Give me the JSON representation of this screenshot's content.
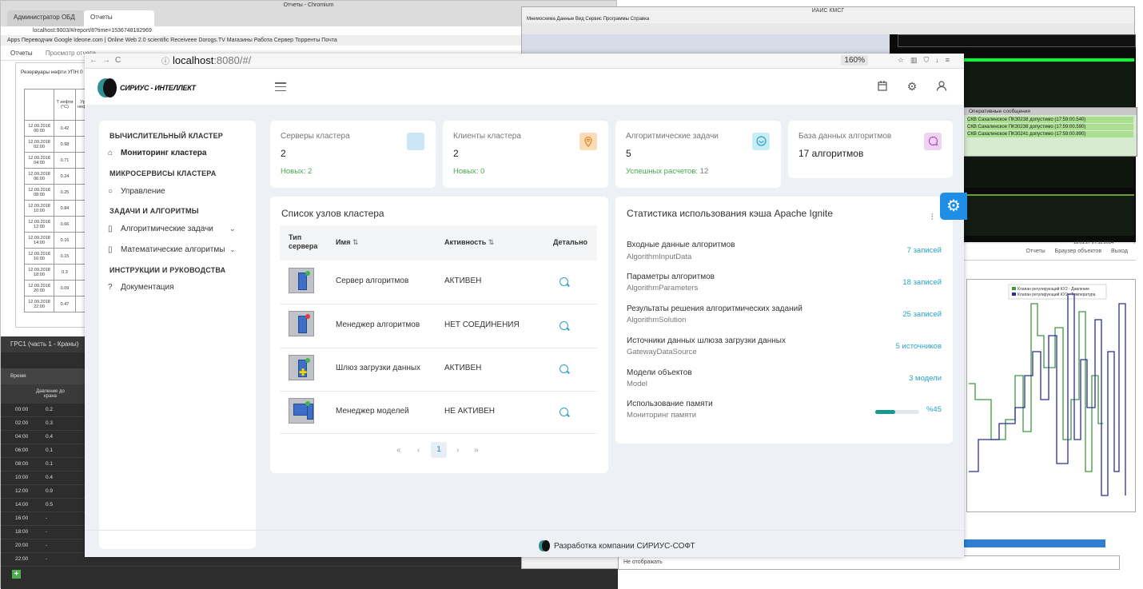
{
  "bg_left": {
    "tab1": "Администратор ОБД",
    "tab2": "Отчеты",
    "window_title": "Отчеты - Chromium",
    "url": "localhost:9003/#/report/8?time=1536748182969",
    "bookmarks": "Apps   Переводчик Google   Ideone.com | Online   Web 2.0 scientific   Receiveee   Dorogs.TV   Магазины   Работа   Сервер   Торренты   Почта",
    "nav_reports": "Отчеты",
    "nav_view": "Просмотр отчета",
    "report_title": "Резервуары нефти УПН 0",
    "table_header": [
      "Т нефти (°C)",
      "Ур нефт"
    ],
    "table_rows": [
      [
        "12.09.2018 00:00",
        "0.42"
      ],
      [
        "12.09.2018 02:00",
        "0.98"
      ],
      [
        "12.09.2018 04:00",
        "0.71"
      ],
      [
        "12.09.2018 06:00",
        "0.24"
      ],
      [
        "12.09.2018 08:00",
        "0.25"
      ],
      [
        "12.09.2018 10:00",
        "0.84"
      ],
      [
        "12.09.2018 12:00",
        "0.66"
      ],
      [
        "12.09.2018 14:00",
        "0.16"
      ],
      [
        "12.09.2018 16:00",
        "0.15"
      ],
      [
        "12.09.2018 18:00",
        "0.3"
      ],
      [
        "12.09.2018 20:00",
        "0.09"
      ],
      [
        "12.09.2018 22:00",
        "0.47"
      ]
    ],
    "dark_title": "ГРС1 (часть 1 - Краны)",
    "dark_col_time": "Время",
    "dark_col_pressure": "Давление до крана",
    "dark_rows": [
      [
        "00:00",
        "0.2"
      ],
      [
        "02:00",
        "0.3"
      ],
      [
        "04:00",
        "0.4"
      ],
      [
        "06:00",
        "0.1"
      ],
      [
        "08:00",
        "0.1"
      ],
      [
        "10:00",
        "0.4"
      ],
      [
        "12:00",
        "0.9"
      ],
      [
        "14:00",
        "0.5"
      ],
      [
        "16:00",
        "-"
      ],
      [
        "18:00",
        "-"
      ],
      [
        "20:00",
        "-"
      ],
      [
        "22:00",
        "-"
      ]
    ]
  },
  "bg_right": {
    "window_title": "ИАИС КМСГ",
    "menu": "Мнемосхема   Данные   Вид   Сервис   Программы   Справка",
    "ops_title": "Оперативные сообщения",
    "ops_lines": [
      "СКВ Сахалинское ПКЗ0238 допустимо (17:59:00.540)",
      "СКВ Сахалинское ПКЗ0238 допустимо (17:59:00.590)",
      "СКВ Сахалинское ПКЗ0241 допустимо (17:59:00.890)"
    ],
    "lower_nav": [
      "Отчеты",
      "Браузер объектов",
      "Выход"
    ],
    "legend1": "Клапан регулирующий КУ2 - Давление",
    "legend2": "Клапан регулирующий КУ2 - Температура",
    "select_value": "Не отображать",
    "clock": "18:01:27  27.11.2014"
  },
  "browser": {
    "url_host": "localhost",
    "url_rest": ":8080/#/",
    "zoom": "160%"
  },
  "app": {
    "logo_text": "СИРИУС - ИНТЕЛЛЕКТ",
    "sidebar": {
      "section1": "ВЫЧИСЛИТЕЛЬНЫЙ КЛАСТЕР",
      "item_monitoring": "Мониторинг кластера",
      "section2": "МИКРОСЕРВИСЫ КЛАСТЕРА",
      "item_management": "Управление",
      "section3": "ЗАДАЧИ И АЛГОРИТМЫ",
      "item_algo_tasks": "Алгоритмические задачи",
      "item_math_algos": "Математические алгоритмы",
      "section4": "ИНСТРУКЦИИ И РУКОВОДСТВА",
      "item_docs": "Документация"
    },
    "stats": [
      {
        "label": "Серверы кластера",
        "value": "2",
        "sub": "Новых: 2"
      },
      {
        "label": "Клиенты кластера",
        "value": "2",
        "sub": "Новых: 0"
      },
      {
        "label": "Алгоритмические задачи",
        "value": "5",
        "sub_prefix": "Успешных расчетов: ",
        "sub_value": "12"
      },
      {
        "label": "База данных алгоритмов",
        "value": "17 алгоритмов"
      }
    ],
    "nodes": {
      "title": "Список узлов кластера",
      "col_type": "Тип сервера",
      "col_name": "Имя",
      "col_activity": "Активность",
      "col_details": "Детально",
      "rows": [
        {
          "name": "Сервер алгоритмов",
          "status": "АКТИВЕН"
        },
        {
          "name": "Менеджер алгоритмов",
          "status": "НЕТ СОЕДИНЕНИЯ"
        },
        {
          "name": "Шлюз загрузки данных",
          "status": "АКТИВЕН"
        },
        {
          "name": "Менеджер моделей",
          "status": "НЕ АКТИВЕН"
        }
      ],
      "pagination": {
        "first": "«",
        "prev": "‹",
        "page": "1",
        "next": "›",
        "last": "»"
      }
    },
    "cache": {
      "title": "Статистика использования кэша Apache Ignite",
      "rows": [
        {
          "label": "Входные данные алгоритмов",
          "sub": "AlgorithmInputData",
          "value": "7 записей"
        },
        {
          "label": "Параметры алгоритмов",
          "sub": "AlgorithmParameters",
          "value": "18 записей"
        },
        {
          "label": "Результаты решения алгоритмических заданий",
          "sub": "AlgorithmSolution",
          "value": "25 записей"
        },
        {
          "label": "Источники данных шлюза загрузки данных",
          "sub": "GatewayDataSource",
          "value": "5 источников"
        },
        {
          "label": "Модели объектов",
          "sub": "Model",
          "value": "3 модели"
        },
        {
          "label": "Использование памяти",
          "sub": "Мониторинг памяти",
          "value": "%45"
        }
      ],
      "memory_fraction": 0.45
    },
    "footer": {
      "prefix": "Разработка компании",
      "company": "СИРИУС-СОФТ"
    },
    "colors": {
      "accent": "#2aa0c8",
      "success": "#45a84a",
      "teal": "#149a8e",
      "fab": "#1f8ee6"
    }
  }
}
